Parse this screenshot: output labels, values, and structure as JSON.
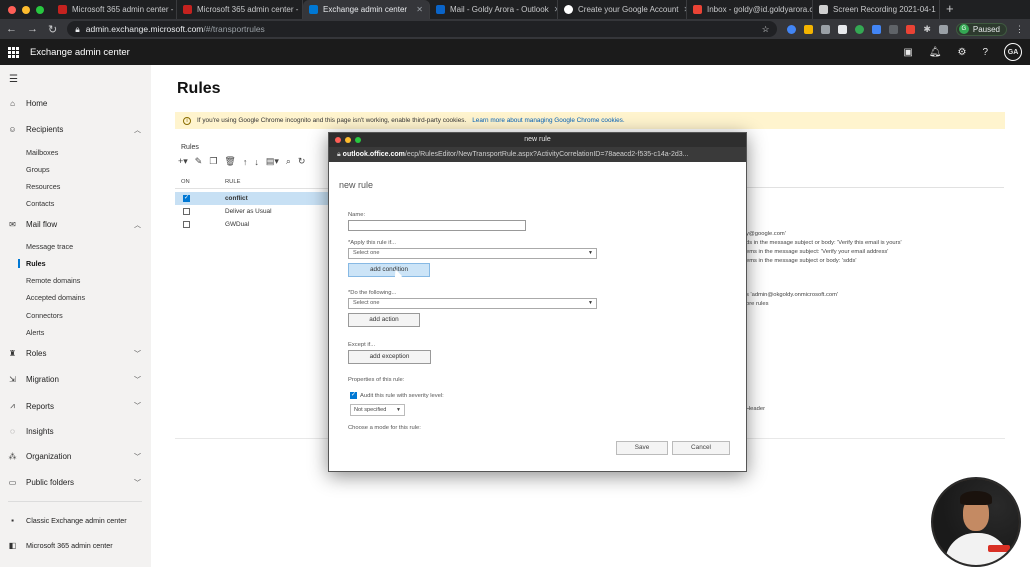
{
  "browser": {
    "tabs": [
      {
        "label": "Microsoft 365 admin center - ",
        "fav": "#c5221f",
        "active": false
      },
      {
        "label": "Microsoft 365 admin center - ",
        "fav": "#c5221f",
        "active": false
      },
      {
        "label": "Exchange admin center",
        "fav": "#0078d4",
        "active": true
      },
      {
        "label": "Mail - Goldy Arora - Outlook",
        "fav": "#0a64c8",
        "active": false
      },
      {
        "label": "Create your Google Account",
        "fav": "#ffffff",
        "active": false
      },
      {
        "label": "Inbox - goldy@id.goldyarora.c",
        "fav": "#ea4335",
        "active": false
      },
      {
        "label": "Screen Recording 2021-04-1",
        "fav": "#cfcfcf",
        "active": false
      }
    ],
    "newtab": "+",
    "url_host": "admin.exchange.microsoft.com",
    "url_path": "/#/transportrules",
    "profile_initial": "G",
    "profile_status": "Paused"
  },
  "app": {
    "title": "Exchange admin center",
    "user_initials": "GA",
    "icons": [
      "monitor-icon",
      "bell-icon",
      "gear-icon",
      "help-icon"
    ]
  },
  "nav": {
    "home": "Home",
    "recipients": "Recipients",
    "recipients_items": [
      "Mailboxes",
      "Groups",
      "Resources",
      "Contacts"
    ],
    "mailflow": "Mail flow",
    "mailflow_items": [
      "Message trace",
      "Rules",
      "Remote domains",
      "Accepted domains",
      "Connectors",
      "Alerts"
    ],
    "roles": "Roles",
    "migration": "Migration",
    "reports": "Reports",
    "insights": "Insights",
    "organization": "Organization",
    "publicfolders": "Public folders",
    "classic": "Classic Exchange admin center",
    "m365": "Microsoft 365 admin center"
  },
  "main": {
    "title": "Rules",
    "banner_text": "If you're using Google Chrome incognito and this page isn't working, enable third-party cookies.",
    "banner_link": "Learn more about managing Google Chrome cookies.",
    "rules_label": "Rules",
    "columns": [
      "ON",
      "RULE"
    ],
    "rows": [
      {
        "on": true,
        "name": "conflict",
        "selected": true
      },
      {
        "on": false,
        "name": "Deliver as Usual",
        "selected": false
      },
      {
        "on": false,
        "name": "GWDual",
        "selected": false
      }
    ],
    "detail_lines": [
      "y@google.com'",
      "ds in the message subject or body: 'Verify this email is yours'",
      "ems in the message subject: 'Verify your email address'",
      "ems in the message subject or body: 'sdds'",
      "s 'admin@okgoldy.onmicrosoft.com'",
      "ore rules",
      "Header"
    ]
  },
  "modal": {
    "window_title": "new rule",
    "url_host": "outlook.office.com",
    "url_path": "/ecp/RulesEditor/NewTransportRule.aspx?ActivityCorrelationID=78aeacd2-f535-c14a-2d3...",
    "heading": "new rule",
    "name_label": "Name:",
    "apply_label": "*Apply this rule if...",
    "apply_select": "Select one",
    "add_condition": "add condition",
    "do_label": "*Do the following...",
    "do_select": "Select one",
    "add_action": "add action",
    "except_label": "Except if...",
    "add_exception": "add exception",
    "properties_label": "Properties of this rule:",
    "audit_label": "Audit this rule with severity level:",
    "severity": "Not specified",
    "mode_label": "Choose a mode for this rule:",
    "save": "Save",
    "cancel": "Cancel"
  }
}
